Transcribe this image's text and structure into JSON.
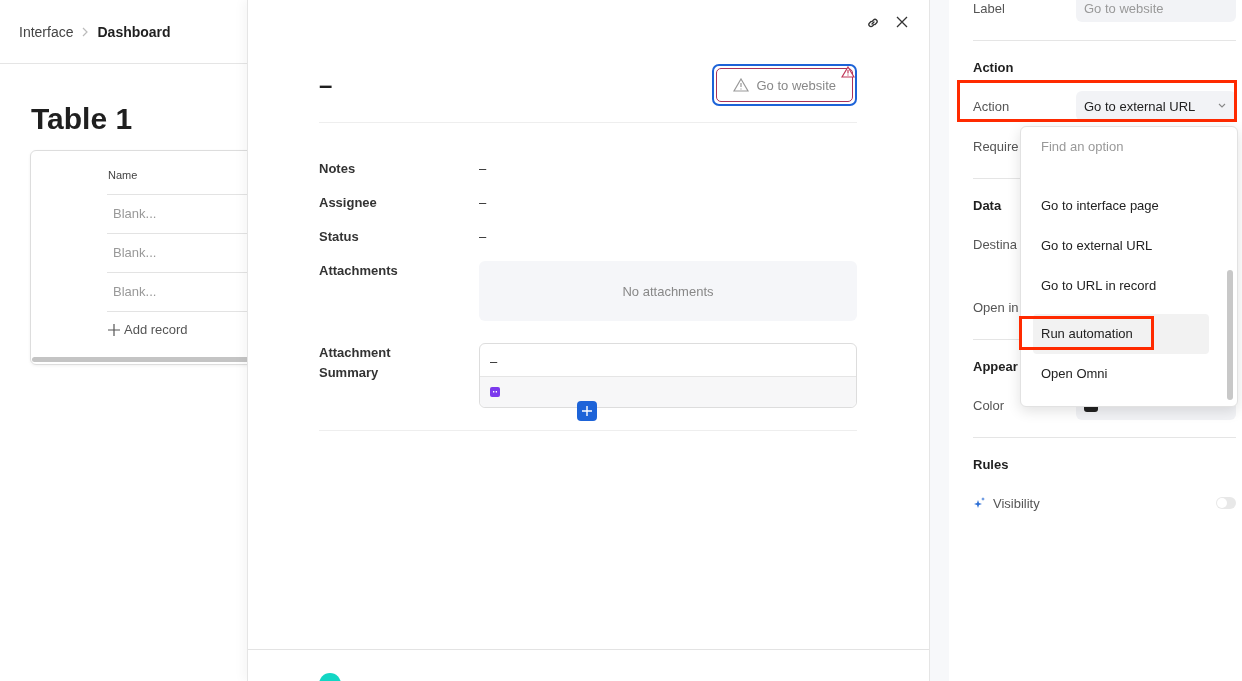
{
  "breadcrumb": {
    "parent": "Interface",
    "current": "Dashboard"
  },
  "page": {
    "title": "Table 1",
    "table": {
      "columns": [
        "Name"
      ],
      "rows": [
        {
          "name": "Blank..."
        },
        {
          "name": "Blank..."
        },
        {
          "name": "Blank..."
        }
      ],
      "add_label": "Add record"
    }
  },
  "record": {
    "title": "–",
    "button": {
      "label": "Go to website",
      "warning": true
    },
    "fields": [
      {
        "label": "Notes",
        "kind": "text",
        "value": "–"
      },
      {
        "label": "Assignee",
        "kind": "text",
        "value": "–"
      },
      {
        "label": "Status",
        "kind": "text",
        "value": "–"
      },
      {
        "label": "Attachments",
        "kind": "attachments",
        "value": "No attachments"
      },
      {
        "label": "Attachment Summary",
        "kind": "summary",
        "value": "–"
      }
    ]
  },
  "settings": {
    "label_row": {
      "label": "Label",
      "placeholder": "Go to website"
    },
    "action_section": {
      "heading": "Action",
      "action_label": "Action",
      "action_value": "Go to external URL",
      "require_label": "Require"
    },
    "data_section": {
      "heading": "Data",
      "destination_label": "Destina",
      "open_in_label": "Open in"
    },
    "appearance_section": {
      "heading": "Appear",
      "color_label": "Color"
    },
    "rules_section": {
      "heading": "Rules",
      "visibility_label": "Visibility",
      "on": false
    }
  },
  "dropdown": {
    "placeholder": "Find an option",
    "options": [
      {
        "label": "Go to interface page",
        "selected": false
      },
      {
        "label": "Go to external URL",
        "selected": false
      },
      {
        "label": "Go to URL in record",
        "selected": false
      },
      {
        "label": "Run automation",
        "selected": true
      },
      {
        "label": "Open Omni",
        "selected": false
      }
    ]
  }
}
